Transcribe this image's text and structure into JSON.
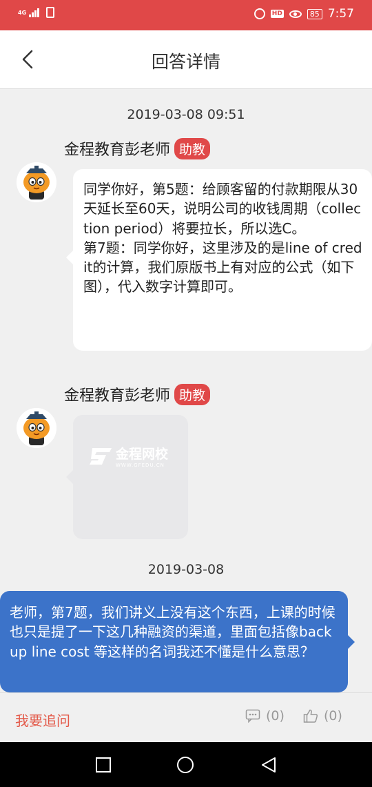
{
  "status_bar": {
    "network": "4G",
    "time": "7:57",
    "battery": "85",
    "hd": "HD"
  },
  "header": {
    "title": "回答详情"
  },
  "messages": [
    {
      "timestamp": "2019-03-08 09:51",
      "sender": "金程教育彭老师",
      "role_badge": "助教",
      "text": "同学你好，第5题：给顾客留的付款期限从30天延长至60天，说明公司的收钱周期（collection period）将要拉长，所以选C。\n第7题：同学你好，这里涉及的是line of credit的计算，我们原版书上有对应的公式（如下图），代入数字计算即可。"
    },
    {
      "sender": "金程教育彭老师",
      "role_badge": "助教",
      "image_brand": "金程网校",
      "image_url_text": "WWW.GFEDU.CN"
    },
    {
      "timestamp": "2019-03-08",
      "text": "老师，第7题，我们讲义上没有这个东西，上课的时候也只是提了一下这几种融资的渠道，里面包括像backup line cost 等这样的名词我还不懂是什么意思？"
    }
  ],
  "bottom_bar": {
    "follow_up_label": "我要追问",
    "comment_count": "(0)",
    "like_count": "(0)"
  },
  "colors": {
    "status_bar": "#e04848",
    "accent_red": "#e35a4a",
    "user_bubble": "#3c73c9"
  }
}
